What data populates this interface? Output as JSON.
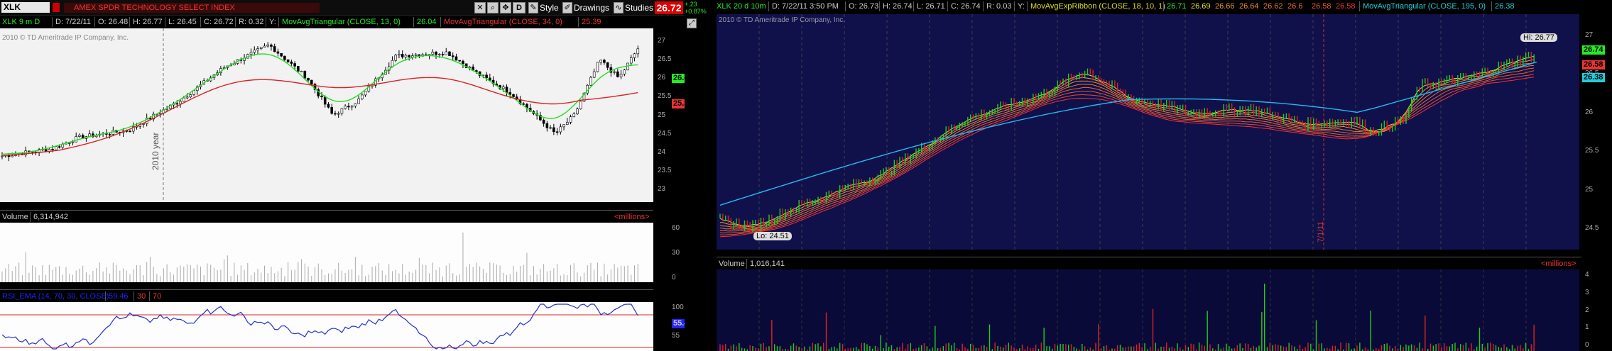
{
  "left": {
    "symbol": "XLK",
    "description": "AMEX SPDR TECHNOLOGY SELECT INDEX",
    "toolbar": {
      "timeframe_label": "D",
      "style_label": "Style",
      "drawings_label": "Drawings",
      "studies_label": "Studies"
    },
    "last_price": "26.72",
    "net_change": "+.23",
    "pct_change": "+0.87%",
    "info": {
      "period": "XLK 9 m D",
      "date": "D: 7/22/11",
      "open": "O: 26.48",
      "high": "H: 26.77",
      "low": "L: 26.45",
      "close": "C: 26.72",
      "range": "R: 0.32",
      "y_label": "Y:",
      "study1_name": "MovAvgTriangular (CLOSE, 13, 0)",
      "study1_value": "26.04",
      "study2_name": "MovAvgTriangular (CLOSE, 34, 0)",
      "study2_value": "25.39"
    },
    "copyright": "2010 © TD Ameritrade IP Company, Inc.",
    "year_marker": "2010 year",
    "price_badges": {
      "last": "26.72",
      "ma13": "26.04",
      "ma34": "25.39"
    },
    "price_axis": [
      "27",
      "26.5",
      "26",
      "25.5",
      "25",
      "24.5",
      "24",
      "23.5",
      "23"
    ],
    "volume": {
      "label": "Volume",
      "value": "6,314,942",
      "units": "<millions>",
      "axis": [
        "60",
        "30",
        "0"
      ]
    },
    "rsi": {
      "name": "RSI_EMA (14, 70, 30, CLOSE)",
      "value": "59.46",
      "ob_label": "30",
      "os_label": "70",
      "axis": [
        "100",
        "55",
        "0"
      ],
      "current": "55.46"
    }
  },
  "right": {
    "info": {
      "period": "XLK 20 d 10m",
      "date": "D: 7/22/11 3:50 PM",
      "open": "O: 26.73",
      "high": "H: 26.74",
      "low": "L: 26.71",
      "close": "C: 26.74",
      "range": "R: 0.03",
      "y_label": "Y:",
      "ribbon_name": "MovAvgExpRibbon (CLOSE, 18, 10, 1)",
      "ribbon_values": [
        "26.71",
        "26.69",
        "26.66",
        "26.64",
        "26.62",
        "26.6",
        "26.58",
        "26.58"
      ],
      "tri_name": "MovAvgTriangular (CLOSE, 195, 0)",
      "tri_value": "26.38"
    },
    "copyright": "2010 © TD Ameritrade IP Company, Inc.",
    "hi_label": "Hi: 26.77",
    "lo_label": "Lo: 24.51",
    "date_marker": "7/1/11",
    "price_badges": {
      "last": "26.74",
      "ribbon": "26.58",
      "tri": "26.38"
    },
    "price_axis": [
      "27",
      "26.5",
      "26",
      "25.5",
      "25",
      "24.5"
    ],
    "volume": {
      "label": "Volume",
      "value": "1,016,141",
      "units": "<millions>",
      "axis": [
        "4",
        "3",
        "2",
        "1",
        "0"
      ]
    }
  },
  "colors": {
    "bull": "#22cc22",
    "bear": "#dd2222",
    "ma_fast": "#22dd22",
    "ma_slow": "#dd2222",
    "triangular_long": "#22bbee",
    "rsi_line": "#2233cc",
    "right_bg": "#10104a"
  }
}
